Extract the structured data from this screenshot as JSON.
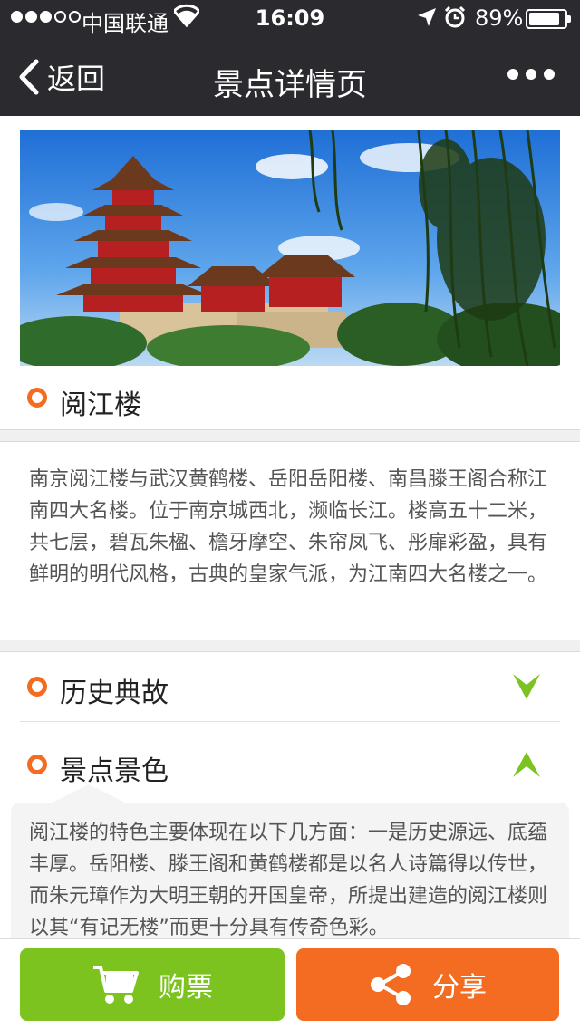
{
  "status_bar": {
    "carrier": "中国联通",
    "time": "16:09",
    "battery": "89%",
    "battery_level": 0.89,
    "signal_bars_filled": 3,
    "signal_bars_total": 5
  },
  "nav": {
    "back_label": "返回",
    "title": "景点详情页"
  },
  "attraction": {
    "name": "阅江楼",
    "intro": "南京阅江楼与武汉黄鹤楼、岳阳岳阳楼、南昌滕王阁合称江南四大名楼。位于南京城西北，濒临长江。楼高五十二米，共七层，碧瓦朱楹、檐牙摩空、朱帘凤飞、彤扉彩盈，具有鲜明的明代风格，古典的皇家气派，为江南四大名楼之一。"
  },
  "sections": [
    {
      "label": "历史典故",
      "expanded": false
    },
    {
      "label": "景点景色",
      "expanded": true,
      "content": "阅江楼的特色主要体现在以下几方面：一是历史源远、底蕴丰厚。岳阳楼、滕王阁和黄鹤楼都是以名人诗篇得以传世，而朱元璋作为大明王朝的开国皇帝，所提出建造的阅江楼则以其“有记无楼”而更十分具有传奇色彩。"
    }
  ],
  "actions": {
    "buy_label": "购票",
    "share_label": "分享"
  },
  "colors": {
    "nav_bg": "#2b2a2f",
    "accent_orange": "#f36c21",
    "accent_green": "#7cc320"
  },
  "icons": {
    "back": "chevron-left-icon",
    "more": "more-dots-icon",
    "bullet": "circle-bullet-icon",
    "collapsed": "chevron-down-icon",
    "expanded": "chevron-up-icon",
    "buy": "cart-icon",
    "share": "share-icon"
  }
}
